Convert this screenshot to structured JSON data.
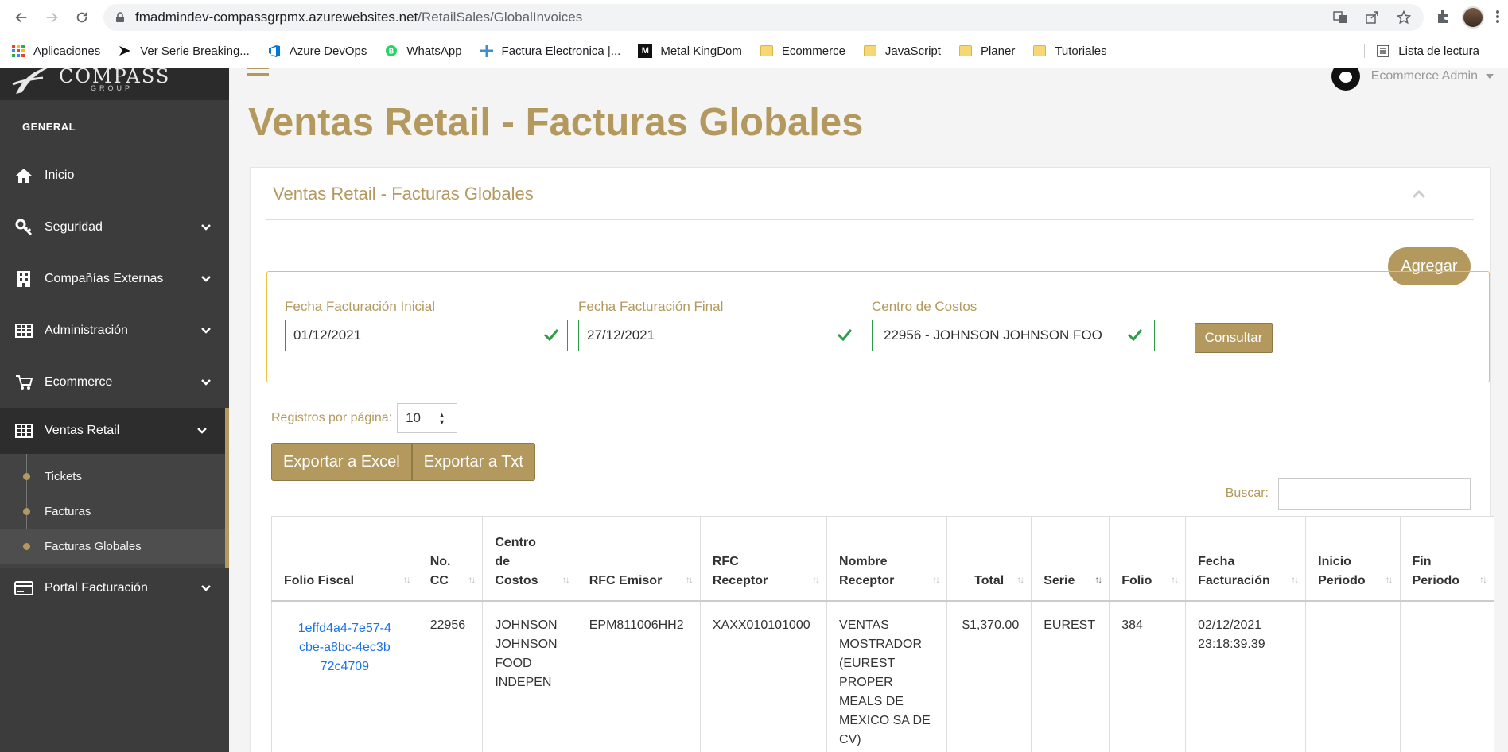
{
  "browser": {
    "url_host": "fmadmindev-compassgrpmx.azurewebsites.net",
    "url_path": "/RetailSales/GlobalInvoices",
    "bookmarks": [
      {
        "label": "Aplicaciones",
        "icon": "apps-grid-icon"
      },
      {
        "label": "Ver Serie Breaking...",
        "icon": "play-icon"
      },
      {
        "label": "Azure DevOps",
        "icon": "azure-devops-icon"
      },
      {
        "label": "WhatsApp",
        "icon": "whatsapp-icon"
      },
      {
        "label": "Factura Electronica |...",
        "icon": "sparkle-icon"
      },
      {
        "label": "Metal KingDom",
        "icon": "m-logo-icon"
      },
      {
        "label": "Ecommerce",
        "icon": "folder-icon"
      },
      {
        "label": "JavaScript",
        "icon": "folder-icon"
      },
      {
        "label": "Planer",
        "icon": "folder-icon"
      },
      {
        "label": "Tutoriales",
        "icon": "folder-icon"
      }
    ],
    "reading_list": "Lista de lectura"
  },
  "brand": {
    "name": "COMPASS",
    "sub": "GROUP"
  },
  "sidebar": {
    "section": "GENERAL",
    "items": [
      {
        "label": "Inicio",
        "icon": "home-icon"
      },
      {
        "label": "Seguridad",
        "icon": "key-icon"
      },
      {
        "label": "Compañías Externas",
        "icon": "building-icon"
      },
      {
        "label": "Administración",
        "icon": "table-icon"
      },
      {
        "label": "Ecommerce",
        "icon": "cart-icon"
      },
      {
        "label": "Ventas Retail",
        "icon": "table-icon"
      },
      {
        "label": "Portal Facturación",
        "icon": "credit-card-icon"
      }
    ],
    "submenu": [
      {
        "label": "Tickets"
      },
      {
        "label": "Facturas"
      },
      {
        "label": "Facturas Globales"
      }
    ]
  },
  "header": {
    "user": "Ecommerce Admin"
  },
  "page": {
    "title": "Ventas Retail - Facturas Globales",
    "panel_title": "Ventas Retail - Facturas Globales",
    "add_label": "Agregar"
  },
  "filters": {
    "start_label": "Fecha Facturación Inicial",
    "start_value": "01/12/2021",
    "end_label": "Fecha Facturación Final",
    "end_value": "27/12/2021",
    "cc_label": "Centro de Costos",
    "cc_value": "22956 - JOHNSON JOHNSON FOO",
    "consult_label": "Consultar"
  },
  "list": {
    "records_label": "Registros por página:",
    "records_value": "10",
    "export_excel": "Exportar a Excel",
    "export_txt": "Exportar a Txt",
    "search_label": "Buscar:"
  },
  "table": {
    "headers": [
      "Folio Fiscal",
      "No. CC",
      "Centro de Costos",
      "RFC Emisor",
      "RFC Receptor",
      "Nombre Receptor",
      "Total",
      "Serie",
      "Folio",
      "Fecha Facturación",
      "Inicio Periodo",
      "Fin Periodo"
    ],
    "rows": [
      {
        "folio_fiscal": "1effd4a4-7e57-4cbe-a8bc-4ec3b72c4709",
        "no_cc": "22956",
        "centro": "JOHNSON JOHNSON FOOD INDEPEN",
        "rfc_emisor": "EPM811006HH2",
        "rfc_receptor": "XAXX010101000",
        "nombre": "VENTAS MOSTRADOR (EUREST PROPER MEALS DE MEXICO SA DE CV)",
        "total": "$1,370.00",
        "serie": "EUREST",
        "folio": "384",
        "fecha": "02/12/2021 23:18:39.39",
        "inicio": "",
        "fin": ""
      }
    ]
  },
  "colors": {
    "accent": "#b3995d",
    "sidebar": "#3c3c3c",
    "valid": "#2e9c4a",
    "link": "#1a73e8"
  }
}
